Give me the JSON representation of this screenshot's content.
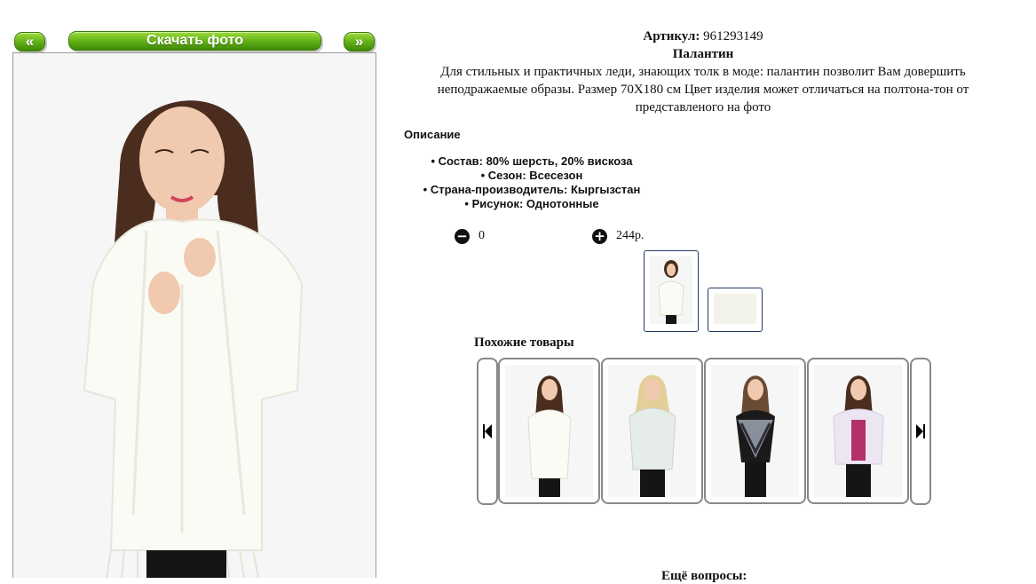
{
  "photo_nav": {
    "prev_label": "«",
    "download_label": "Скачать фото",
    "next_label": "»"
  },
  "product": {
    "sku_label": "Артикул:",
    "sku_value": "961293149",
    "title": "Палантин",
    "description": "Для стильных и практичных леди, знающих толк в моде: палантин позволит Вам довершить неподражаемые образы. Размер 70Х180 см Цвет изделия может отличаться на полтона-тон от представленого на фото"
  },
  "specs": {
    "heading": "Описание",
    "items": [
      "Состав: 80% шерсть, 20% вискоза",
      "Сезон: Всесезон",
      "Страна-производитель: Кыргызстан",
      "Рисунок: Однотонные"
    ]
  },
  "cart": {
    "quantity": "0",
    "price": "244р."
  },
  "similar": {
    "heading": "Похожие товары",
    "items": [
      {
        "name": "similar-white-stole"
      },
      {
        "name": "similar-light-stole"
      },
      {
        "name": "similar-patterned-stole"
      },
      {
        "name": "similar-lilac-stole"
      }
    ]
  },
  "footer_text": "Ещё вопросы:",
  "colors": {
    "button_green": "#5fae14",
    "thumb_border": "#1f3b66",
    "card_border": "#888888"
  }
}
